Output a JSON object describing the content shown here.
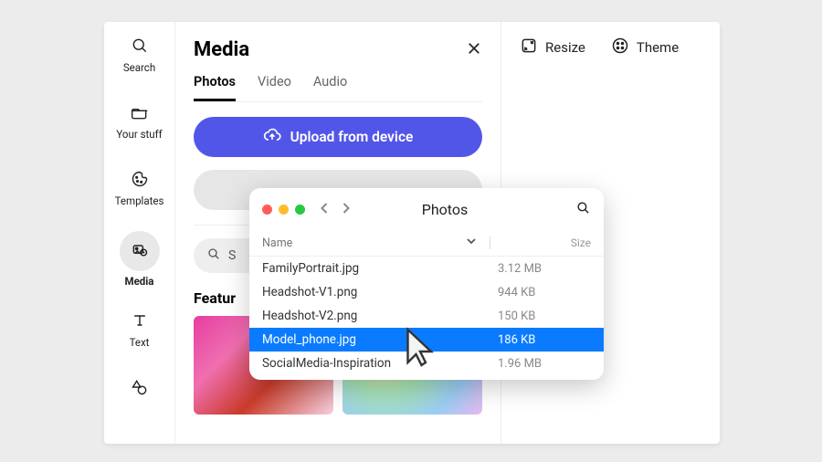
{
  "sidebar": {
    "items": [
      {
        "label": "Search"
      },
      {
        "label": "Your stuff"
      },
      {
        "label": "Templates"
      },
      {
        "label": "Media"
      },
      {
        "label": "Text"
      }
    ]
  },
  "panel": {
    "title": "Media",
    "tabs": [
      {
        "label": "Photos",
        "active": true
      },
      {
        "label": "Video"
      },
      {
        "label": "Audio"
      }
    ],
    "upload_label": "Upload from device",
    "search_placeholder": "S",
    "featured_title": "Featur"
  },
  "topbar": {
    "resize_label": "Resize",
    "theme_label": "Theme"
  },
  "filedialog": {
    "title": "Photos",
    "columns": {
      "name": "Name",
      "size": "Size"
    },
    "rows": [
      {
        "name": "FamilyPortrait.jpg",
        "size": "3.12 MB",
        "selected": false
      },
      {
        "name": "Headshot-V1.png",
        "size": "944 KB",
        "selected": false
      },
      {
        "name": "Headshot-V2.png",
        "size": "150 KB",
        "selected": false
      },
      {
        "name": "Model_phone.jpg",
        "size": "186 KB",
        "selected": true
      },
      {
        "name": "SocialMedia-Inspiration",
        "size": "1.96 MB",
        "selected": false
      }
    ]
  }
}
